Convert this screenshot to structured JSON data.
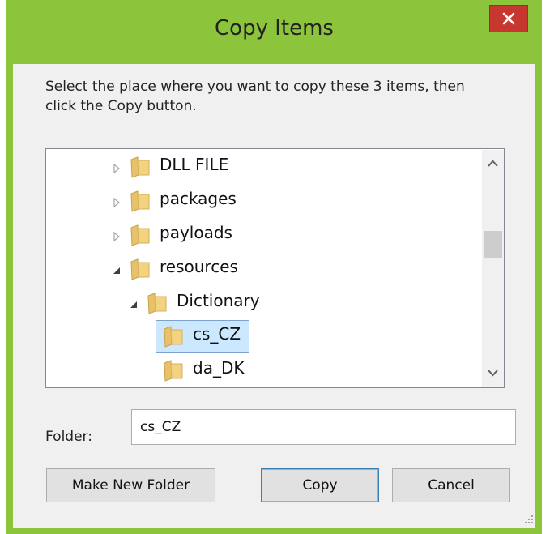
{
  "window": {
    "title": "Copy Items",
    "accent_color": "#8cc43c",
    "close_color": "#c7372f"
  },
  "instruction": "Select the place where you want to copy these 3 items, then click the Copy button.",
  "tree": {
    "items": [
      {
        "label": "DLL FILE",
        "state": "collapsed",
        "level": 0
      },
      {
        "label": "packages",
        "state": "collapsed",
        "level": 0
      },
      {
        "label": "payloads",
        "state": "collapsed",
        "level": 0
      },
      {
        "label": "resources",
        "state": "expanded",
        "level": 0
      },
      {
        "label": "Dictionary",
        "state": "expanded",
        "level": 1
      },
      {
        "label": "cs_CZ",
        "state": "leaf",
        "level": 2,
        "selected": true
      },
      {
        "label": "da_DK",
        "state": "leaf",
        "level": 2
      }
    ]
  },
  "folder": {
    "label": "Folder:",
    "value": "cs_CZ"
  },
  "buttons": {
    "make_new_folder": "Make New Folder",
    "copy": "Copy",
    "cancel": "Cancel"
  }
}
